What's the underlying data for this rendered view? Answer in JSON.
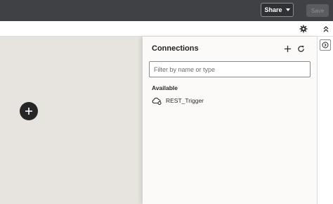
{
  "header": {
    "share_label": "Share",
    "save_label": "Save"
  },
  "panel": {
    "title": "Connections",
    "filter_placeholder": "Filter by name or type",
    "section_label": "Available",
    "connections": [
      {
        "label": "REST_Trigger"
      }
    ]
  },
  "icons": {
    "gear": "gear-icon",
    "collapse": "double-chevron-up-icon",
    "add": "plus-icon",
    "refresh": "refresh-icon",
    "canvas_add": "plus-circle-icon",
    "connection": "cloud-trigger-icon",
    "rail": "circle-arrow-right-icon"
  },
  "colors": {
    "topbar": "#3f4145",
    "canvas": "#e7e4df",
    "panel": "#fbfaf9",
    "add_circle": "#262626"
  }
}
